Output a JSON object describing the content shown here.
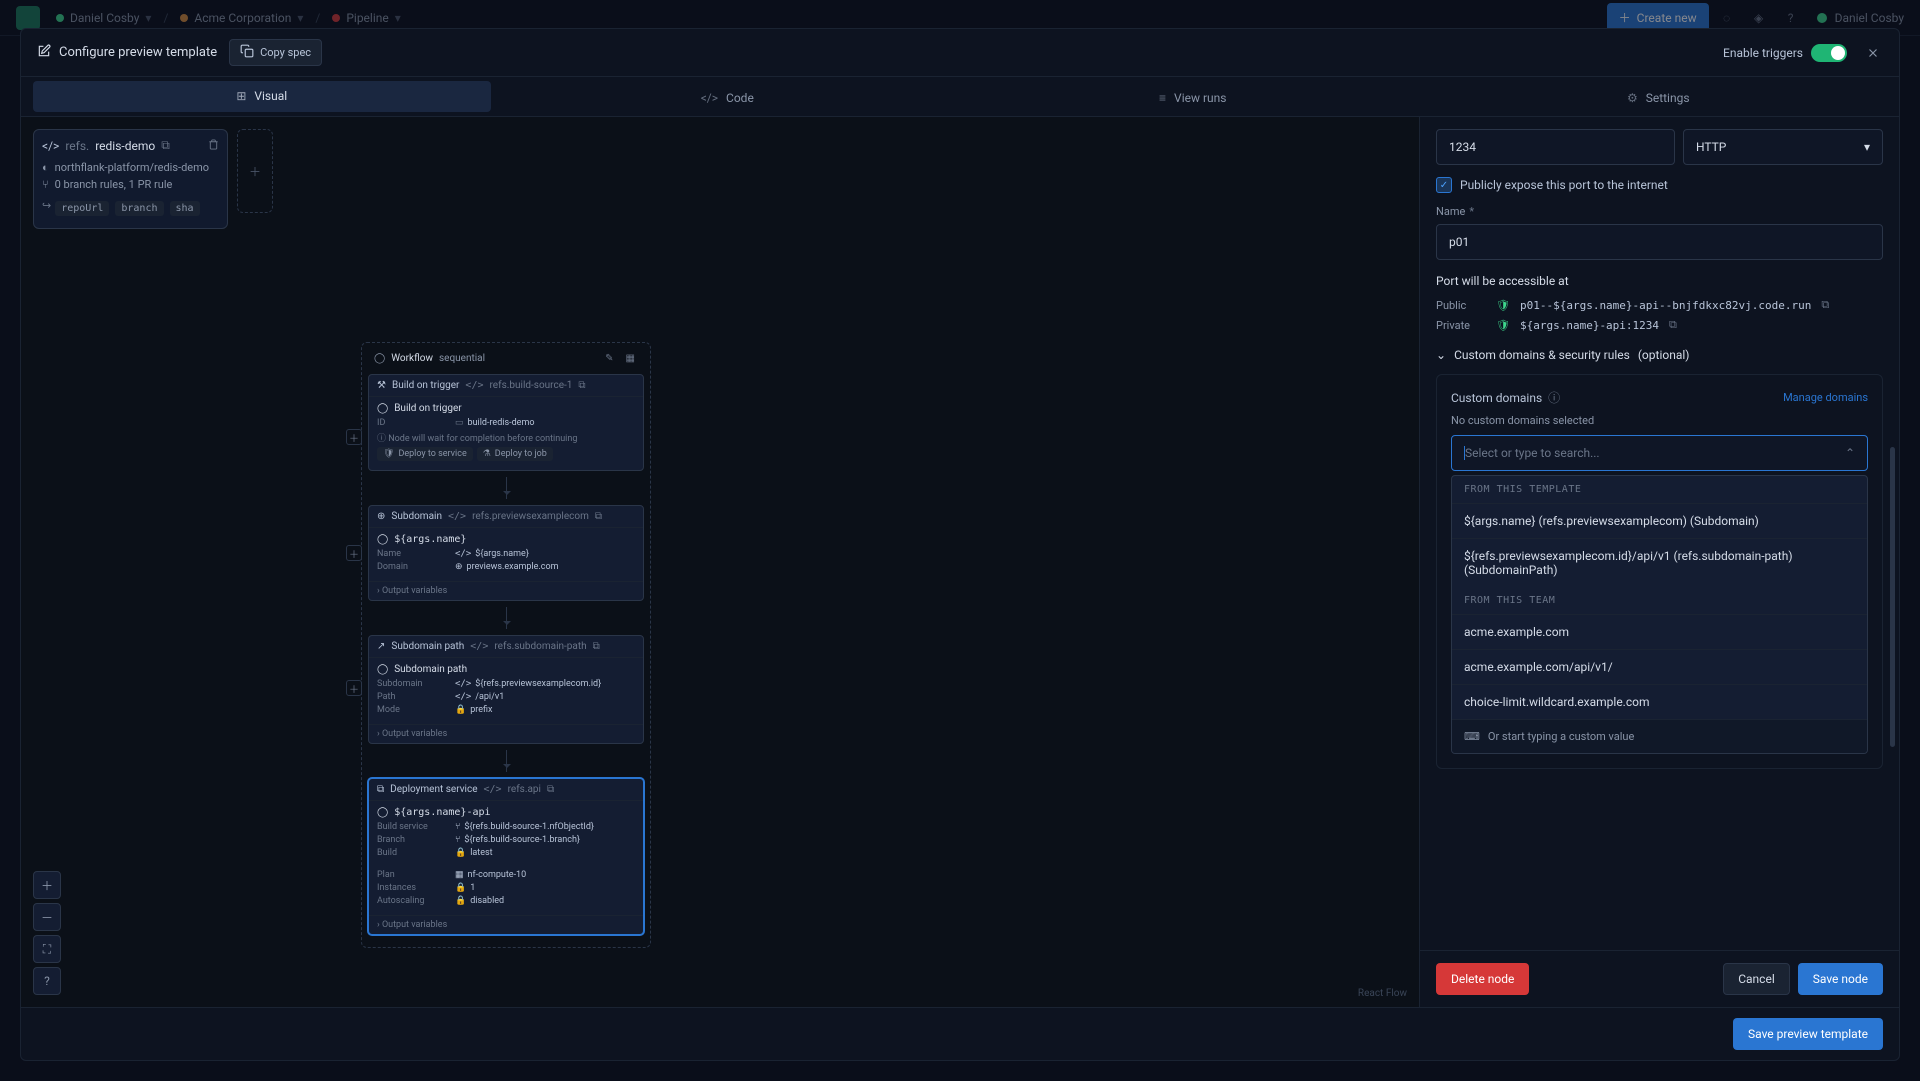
{
  "topnav": {
    "user": "Daniel Cosby",
    "org": "Acme Corporation",
    "project": "Pipeline",
    "create_new": "Create new",
    "right_user": "Daniel Cosby"
  },
  "modal": {
    "title": "Configure preview template",
    "copy_spec": "Copy spec",
    "enable_triggers": "Enable triggers"
  },
  "tabs": {
    "visual": "Visual",
    "code": "Code",
    "view_runs": "View runs",
    "settings": "Settings"
  },
  "source": {
    "prefix": "refs.",
    "name": "redis-demo",
    "repo": "northflank-platform/redis-demo",
    "rules": "0 branch rules, 1 PR rule",
    "tags": [
      "repoUrl",
      "branch",
      "sha"
    ]
  },
  "workflow": {
    "header": "Workflow",
    "mode": "sequential",
    "n1": {
      "type": "Build on trigger",
      "ref": "refs.build-source-1",
      "title": "Build on trigger",
      "id_label": "ID",
      "id_val": "build-redis-demo",
      "note": "Node will wait for completion before continuing",
      "deploy_service": "Deploy to service",
      "deploy_job": "Deploy to job"
    },
    "n2": {
      "type": "Subdomain",
      "ref": "refs.previewsexamplecom",
      "title": "${args.name}",
      "name_k": "Name",
      "name_v": "${args.name}",
      "domain_k": "Domain",
      "domain_v": "previews.example.com",
      "ov": "Output variables"
    },
    "n3": {
      "type": "Subdomain path",
      "ref": "refs.subdomain-path",
      "title": "Subdomain path",
      "sub_k": "Subdomain",
      "sub_v": "${refs.previewsexamplecom.id}",
      "path_k": "Path",
      "path_v": "/api/v1",
      "mode_k": "Mode",
      "mode_v": "prefix",
      "ov": "Output variables"
    },
    "n4": {
      "type": "Deployment service",
      "ref": "refs.api",
      "title": "${args.name}-api",
      "bs_k": "Build service",
      "bs_v": "${refs.build-source-1.nfObjectId}",
      "br_k": "Branch",
      "br_v": "${refs.build-source-1.branch}",
      "bl_k": "Build",
      "bl_v": "latest",
      "plan_k": "Plan",
      "plan_v": "nf-compute-10",
      "inst_k": "Instances",
      "inst_v": "1",
      "as_k": "Autoscaling",
      "as_v": "disabled",
      "ov": "Output variables"
    }
  },
  "react_flow": "React Flow",
  "panel": {
    "port_value": "1234",
    "protocol": "HTTP",
    "expose_label": "Publicly expose this port to the internet",
    "name_label": "Name",
    "name_value": "p01",
    "accessible_header": "Port will be accessible at",
    "public_label": "Public",
    "public_url": "p01--${args.name}-api--bnjfdkxc82vj.code.run",
    "private_label": "Private",
    "private_url": "${args.name}-api:1234",
    "custom_domains_header": "Custom domains & security rules",
    "optional": "(optional)",
    "cd_title": "Custom domains",
    "manage": "Manage domains",
    "none_selected": "No custom domains selected",
    "search_placeholder": "Select or type to search...",
    "group1": "FROM THIS TEMPLATE",
    "opt1": "${args.name} (refs.previewsexamplecom) (Subdomain)",
    "opt2": "${refs.previewsexamplecom.id}/api/v1 (refs.subdomain-path) (SubdomainPath)",
    "group2": "FROM THIS TEAM",
    "opt3": "acme.example.com",
    "opt4": "acme.example.com/api/v1/",
    "opt5": "choice-limit.wildcard.example.com",
    "custom_hint": "Or start typing a custom value"
  },
  "footer": {
    "delete": "Delete node",
    "cancel": "Cancel",
    "save_node": "Save node",
    "save_template": "Save preview template"
  }
}
